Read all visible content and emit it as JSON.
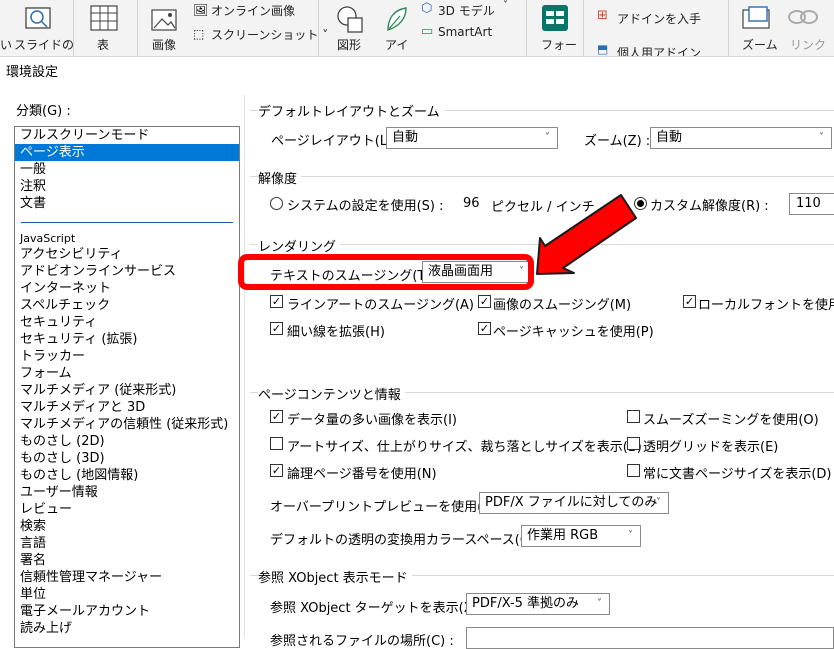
{
  "ribbon": {
    "items": [
      "スライドの",
      "表",
      "画像",
      "オンライン画像",
      "スクリーンショット ˅",
      "図形",
      "アイ",
      "3D モデル",
      "SmartArt",
      "フォー",
      "アドインを入手",
      "個人用アドイン",
      "ズーム",
      "リンク"
    ],
    "slide_fragment": "い"
  },
  "dialog": {
    "title": "環境設定"
  },
  "categories": {
    "label": "分類(G) :",
    "top_items": [
      "フルスクリーンモード",
      "ページ表示",
      "一般",
      "注釈",
      "文書"
    ],
    "selected": "ページ表示",
    "items": [
      "JavaScript",
      "アクセシビリティ",
      "アドビオンラインサービス",
      "インターネット",
      "スペルチェック",
      "セキュリティ",
      "セキュリティ (拡張)",
      "トラッカー",
      "フォーム",
      "マルチメディア (従来形式)",
      "マルチメディアと 3D",
      "マルチメディアの信頼性 (従来形式)",
      "ものさし (2D)",
      "ものさし (3D)",
      "ものさし (地図情報)",
      "ユーザー情報",
      "レビュー",
      "検索",
      "言語",
      "署名",
      "信頼性管理マネージャー",
      "単位",
      "電子メールアカウント",
      "読み上げ"
    ]
  },
  "layout_zoom": {
    "title": "デフォルトレイアウトとズーム",
    "page_layout_label": "ページレイアウト(L) :",
    "page_layout_value": "自動",
    "zoom_label": "ズーム(Z) :",
    "zoom_value": "自動"
  },
  "resolution": {
    "title": "解像度",
    "system_label": "システムの設定を使用(S) :",
    "system_value": "96",
    "unit": "ピクセル / インチ",
    "custom_label": "カスタム解像度(R) :",
    "custom_value": "110",
    "selected": "custom"
  },
  "rendering": {
    "title": "レンダリング",
    "smoothing_label": "テキストのスムージング(T) :",
    "smoothing_value": "液晶画面用",
    "options": [
      {
        "label": "ラインアートのスムージング(A)",
        "checked": true
      },
      {
        "label": "画像のスムージング(M)",
        "checked": true
      },
      {
        "label": "ローカルフォントを使用(F)",
        "checked": true
      },
      {
        "label": "細い線を拡張(H)",
        "checked": true
      },
      {
        "label": "ページキャッシュを使用(P)",
        "checked": true
      }
    ]
  },
  "content": {
    "title": "ページコンテンツと情報",
    "options": [
      {
        "label": "データ量の多い画像を表示(I)",
        "checked": true
      },
      {
        "label": "スムーズズーミングを使用(O)",
        "checked": false
      },
      {
        "label": "アートサイズ、仕上がりサイズ、裁ち落としサイズを表示(B)",
        "checked": false
      },
      {
        "label": "透明グリッドを表示(E)",
        "checked": false
      },
      {
        "label": "論理ページ番号を使用(N)",
        "checked": true
      },
      {
        "label": "常に文書ページサイズを表示(D)",
        "checked": false
      }
    ],
    "overprint_label": "オーバープリントプレビューを使用(W) :",
    "overprint_value": "PDF/X ファイルに対してのみ",
    "colorspace_label": "デフォルトの透明の変換用カラースペース(C) :",
    "colorspace_value": "作業用 RGB"
  },
  "xobject": {
    "title": "参照 XObject 表示モード",
    "target_label": "参照 XObject ターゲットを表示(X) :",
    "target_value": "PDF/X-5 準拠のみ",
    "location_label": "参照されるファイルの場所(C) :"
  },
  "colors": {
    "selection": "#0078d7",
    "highlight": "#ff0000"
  }
}
